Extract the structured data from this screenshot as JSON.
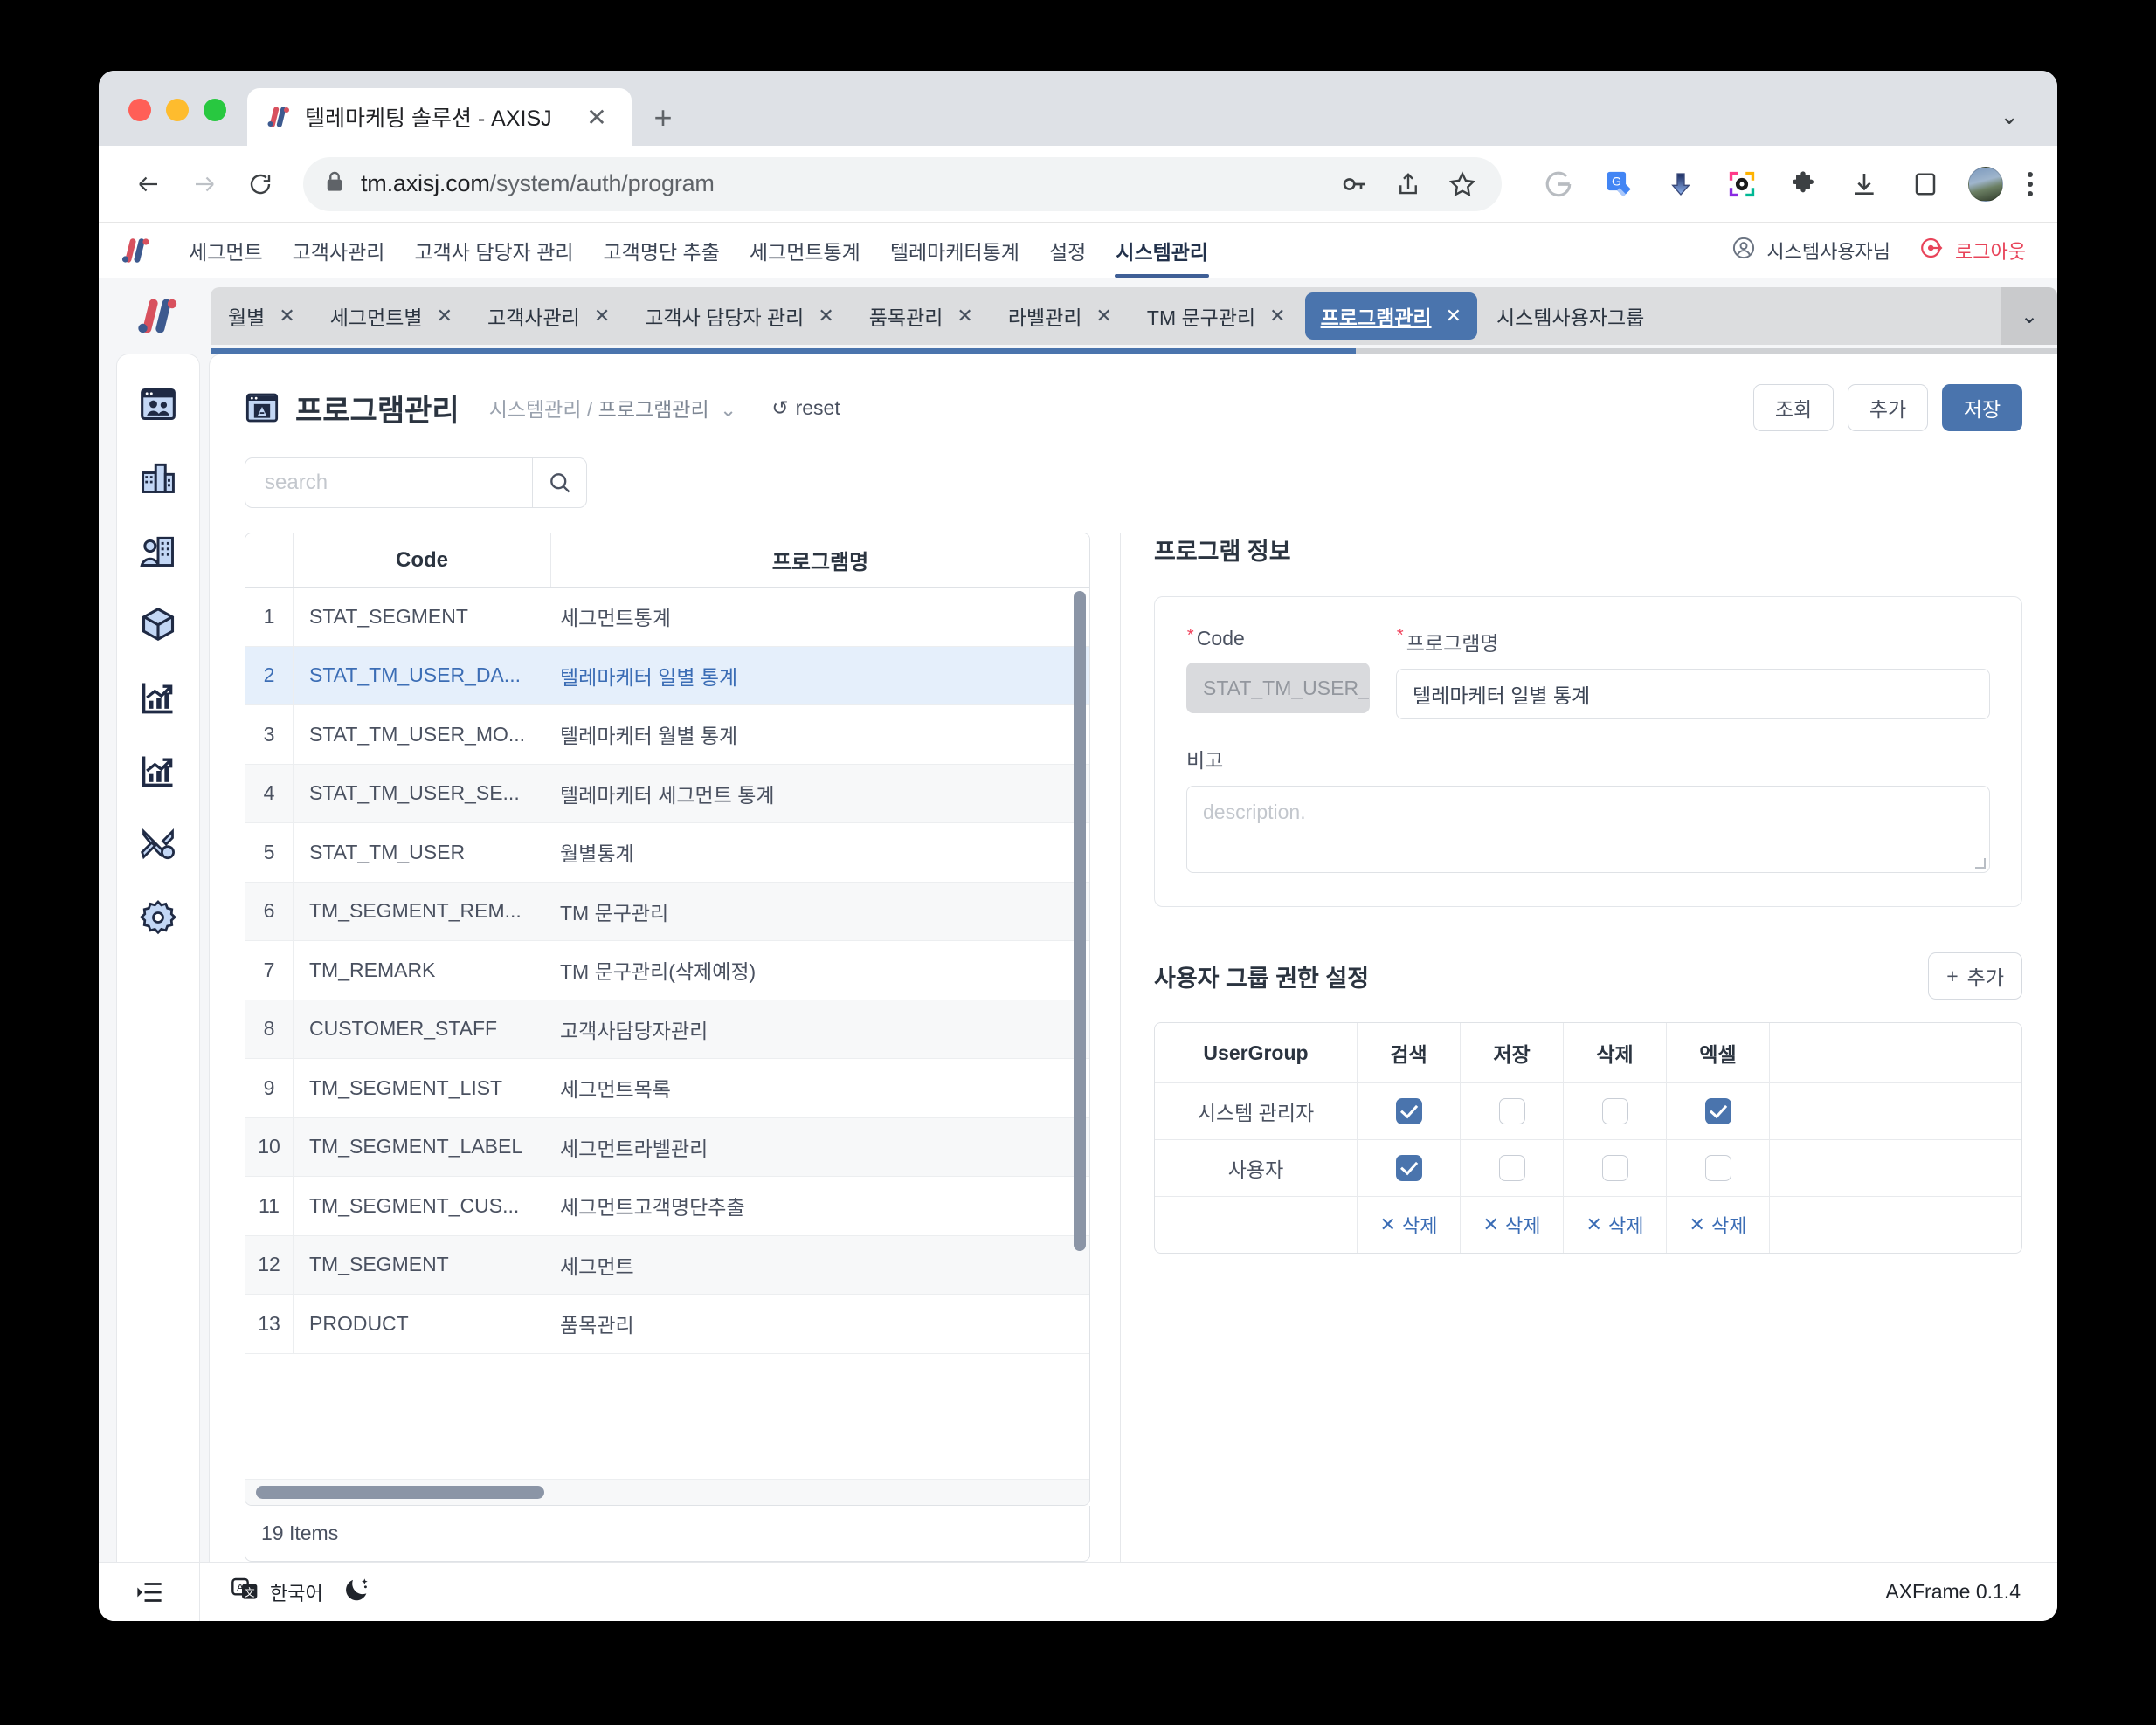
{
  "browser": {
    "tab_title": "텔레마케팅 솔루션 - AXISJ",
    "tab_close": "✕",
    "new_tab": "+",
    "window_chevron": "⌄",
    "back": "←",
    "forward": "→",
    "reload": "⟳",
    "url_host": "tm.axisj.com",
    "url_path": "/system/auth/program"
  },
  "appnav": {
    "items": [
      {
        "label": "세그먼트",
        "active": false
      },
      {
        "label": "고객사관리",
        "active": false
      },
      {
        "label": "고객사 담당자 관리",
        "active": false
      },
      {
        "label": "고객명단 추출",
        "active": false
      },
      {
        "label": "세그먼트통계",
        "active": false
      },
      {
        "label": "텔레마케터통계",
        "active": false
      },
      {
        "label": "설정",
        "active": false
      },
      {
        "label": "시스템관리",
        "active": true
      }
    ],
    "user": "시스템사용자님",
    "logout": "로그아웃"
  },
  "tabbar": {
    "tabs": [
      {
        "label": "월별",
        "active": false,
        "close": "✕"
      },
      {
        "label": "세그먼트별",
        "active": false,
        "close": "✕"
      },
      {
        "label": "고객사관리",
        "active": false,
        "close": "✕"
      },
      {
        "label": "고객사 담당자 관리",
        "active": false,
        "close": "✕"
      },
      {
        "label": "품목관리",
        "active": false,
        "close": "✕"
      },
      {
        "label": "라벨관리",
        "active": false,
        "close": "✕"
      },
      {
        "label": "TM 문구관리",
        "active": false,
        "close": "✕"
      },
      {
        "label": "프로그램관리",
        "active": true,
        "close": "✕"
      },
      {
        "label": "시스템사용자그룹",
        "active": false,
        "close": "✕"
      }
    ],
    "more": "⌄"
  },
  "rail": {
    "items": [
      {
        "name": "segment-icon"
      },
      {
        "name": "company-icon"
      },
      {
        "name": "company-staff-icon"
      },
      {
        "name": "product-box-icon"
      },
      {
        "name": "segment-stats-icon"
      },
      {
        "name": "telemarketer-stats-icon"
      },
      {
        "name": "settings-tools-icon"
      },
      {
        "name": "system-gear-icon"
      }
    ]
  },
  "page": {
    "title": "프로그램관리",
    "breadcrumb_root": "시스템관리",
    "breadcrumb_sep": "/",
    "breadcrumb_current": "프로그램관리",
    "breadcrumb_chevron": "⌄",
    "reset_label": "reset",
    "reset_icon": "↺",
    "actions": {
      "search": "조회",
      "add": "추가",
      "save": "저장"
    }
  },
  "search": {
    "placeholder": "search",
    "value": ""
  },
  "grid": {
    "columns": [
      "",
      "Code",
      "프로그램명"
    ],
    "rows": [
      {
        "no": "1",
        "code": "STAT_SEGMENT",
        "name": "세그먼트통계"
      },
      {
        "no": "2",
        "code": "STAT_TM_USER_DA...",
        "name": "텔레마케터 일별 통계"
      },
      {
        "no": "3",
        "code": "STAT_TM_USER_MO...",
        "name": "텔레마케터 월별 통계"
      },
      {
        "no": "4",
        "code": "STAT_TM_USER_SE...",
        "name": "텔레마케터 세그먼트 통계"
      },
      {
        "no": "5",
        "code": "STAT_TM_USER",
        "name": "월별통계"
      },
      {
        "no": "6",
        "code": "TM_SEGMENT_REM...",
        "name": "TM 문구관리"
      },
      {
        "no": "7",
        "code": "TM_REMARK",
        "name": "TM 문구관리(삭제예정)"
      },
      {
        "no": "8",
        "code": "CUSTOMER_STAFF",
        "name": "고객사담당자관리"
      },
      {
        "no": "9",
        "code": "TM_SEGMENT_LIST",
        "name": "세그먼트목록"
      },
      {
        "no": "10",
        "code": "TM_SEGMENT_LABEL",
        "name": "세그먼트라벨관리"
      },
      {
        "no": "11",
        "code": "TM_SEGMENT_CUS...",
        "name": "세그먼트고객명단추출"
      },
      {
        "no": "12",
        "code": "TM_SEGMENT",
        "name": "세그먼트"
      },
      {
        "no": "13",
        "code": "PRODUCT",
        "name": "품목관리"
      }
    ],
    "selected_row": 2,
    "footer": "19 Items"
  },
  "info": {
    "section_title": "프로그램 정보",
    "code_label": "Code",
    "code_value": "STAT_TM_USER_D",
    "name_label": "프로그램명",
    "name_value": "텔레마케터 일별 통계",
    "remark_label": "비고",
    "remark_placeholder": "description.",
    "required_mark": "*"
  },
  "permissions": {
    "section_title": "사용자 그룹 권한 설정",
    "add_label": "추가",
    "add_icon": "+",
    "columns": [
      "UserGroup",
      "검색",
      "저장",
      "삭제",
      "엑셀"
    ],
    "rows": [
      {
        "group": "시스템 관리자",
        "perms": [
          true,
          false,
          false,
          true
        ]
      },
      {
        "group": "사용자",
        "perms": [
          true,
          false,
          false,
          false
        ]
      }
    ],
    "delete_label": "삭제",
    "delete_icon": "✕"
  },
  "statusbar": {
    "menu_icon": "list-toggle-icon",
    "language": "한국어",
    "theme_icon": "moon-icon",
    "version": "AXFrame 0.1.4"
  },
  "colors": {
    "accent": "#4a74ad",
    "danger": "#e8445a",
    "link": "#3b6db5",
    "selected_row": "#e5effb"
  }
}
